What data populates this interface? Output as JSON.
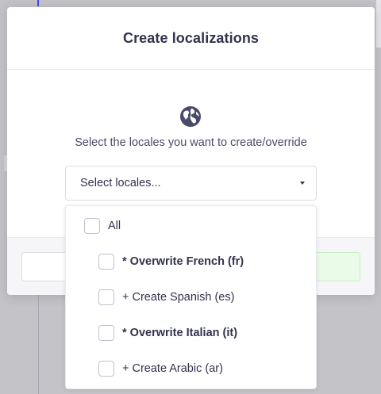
{
  "modal": {
    "title": "Create localizations",
    "globe_icon": "globe-icon",
    "prompt": "Select the locales you want to create/override"
  },
  "locale_select": {
    "placeholder": "Select locales...",
    "caret_icon": "chevron-down-icon"
  },
  "dropdown": {
    "options": [
      {
        "label": "All",
        "bold": false
      },
      {
        "label": "* Overwrite French (fr)",
        "bold": true
      },
      {
        "label": "+ Create Spanish (es)",
        "bold": false
      },
      {
        "label": "* Overwrite Italian (it)",
        "bold": true
      },
      {
        "label": "+ Create Arabic (ar)",
        "bold": false
      }
    ]
  },
  "colors": {
    "text": "#32324d",
    "muted": "#4a4a6a",
    "border": "#dcdce4",
    "confirm_bg": "#eafbe7",
    "backdrop": "#c4c4c8",
    "accent": "#4945ff"
  }
}
